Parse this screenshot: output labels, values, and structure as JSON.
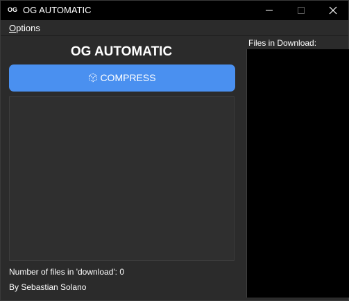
{
  "window": {
    "title": "OG AUTOMATIC",
    "icon_name": "og-app-icon",
    "icon_text": "OG"
  },
  "menu": {
    "options_mnemonic": "O",
    "options_rest": "ptions"
  },
  "main": {
    "heading": "OG AUTOMATIC",
    "compress_label": "COMPRESS",
    "compress_icon": "cube-icon",
    "file_count_text": "Number of files in 'download': 0",
    "author_text": "By Sebastian Solano"
  },
  "side": {
    "files_label": "Files in Download:"
  },
  "colors": {
    "accent": "#4a90f0",
    "background": "#2b2b2b",
    "titlebar": "#000000",
    "list_background": "#000000"
  }
}
